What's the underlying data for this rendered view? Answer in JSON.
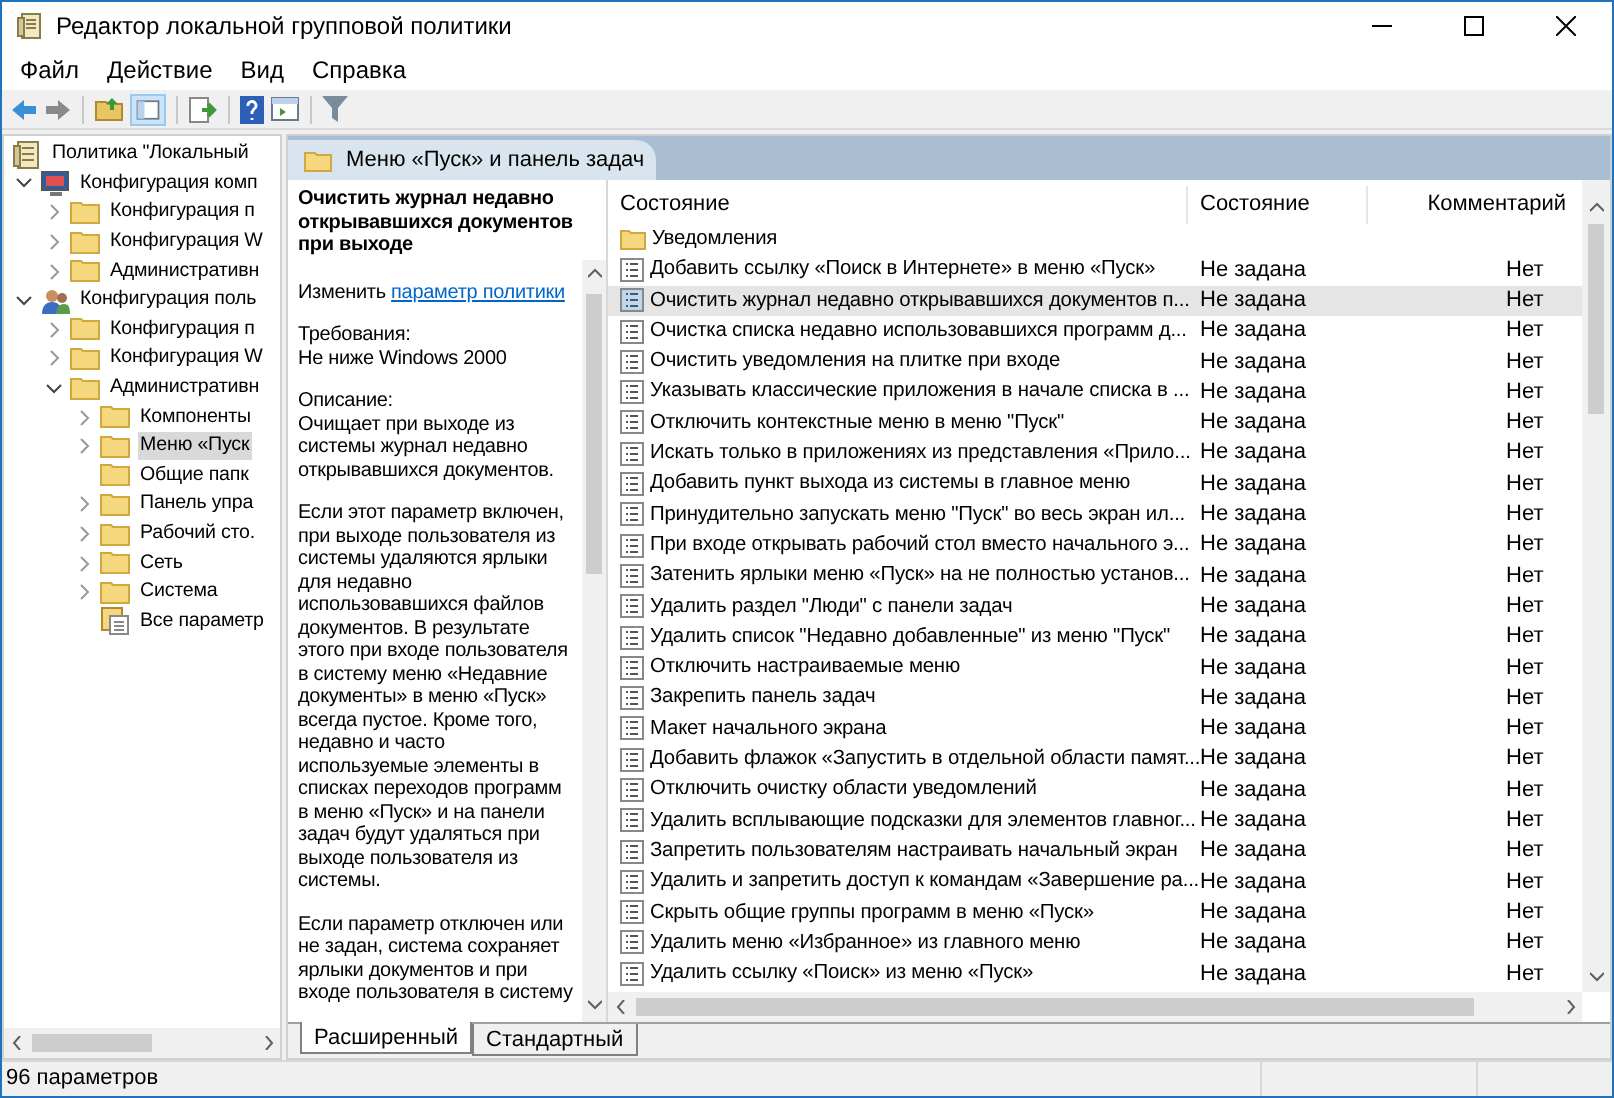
{
  "window": {
    "title": "Редактор локальной групповой политики"
  },
  "menu": [
    "Файл",
    "Действие",
    "Вид",
    "Справка"
  ],
  "tree": [
    {
      "label": "Политика \"Локальный",
      "kind": "policy",
      "selected": false,
      "children": [
        {
          "label": "Конфигурация комп",
          "kind": "computer",
          "expanded": true,
          "selected": false,
          "children": [
            {
              "label": "Конфигурация п",
              "kind": "folder",
              "expanded": false,
              "selected": false
            },
            {
              "label": "Конфигурация W",
              "kind": "folder",
              "expanded": false,
              "selected": false
            },
            {
              "label": "Административн",
              "kind": "folder",
              "expanded": false,
              "selected": false
            }
          ]
        },
        {
          "label": "Конфигурация поль",
          "kind": "user",
          "expanded": true,
          "selected": false,
          "children": [
            {
              "label": "Конфигурация п",
              "kind": "folder",
              "expanded": false,
              "selected": false
            },
            {
              "label": "Конфигурация W",
              "kind": "folder",
              "expanded": false,
              "selected": false
            },
            {
              "label": "Административн",
              "kind": "folder",
              "expanded": true,
              "selected": false,
              "children": [
                {
                  "label": "Компоненты",
                  "kind": "folder",
                  "expanded": false,
                  "selected": false
                },
                {
                  "label": "Меню «Пуск",
                  "kind": "folder",
                  "expanded": false,
                  "selected": true
                },
                {
                  "label": "Общие папк",
                  "kind": "folder",
                  "selected": false
                },
                {
                  "label": "Панель упра",
                  "kind": "folder",
                  "expanded": false,
                  "selected": false
                },
                {
                  "label": "Рабочий сто.",
                  "kind": "folder",
                  "expanded": false,
                  "selected": false
                },
                {
                  "label": "Сеть",
                  "kind": "folder",
                  "expanded": false,
                  "selected": false
                },
                {
                  "label": "Система",
                  "kind": "folder",
                  "expanded": false,
                  "selected": false
                },
                {
                  "label": "Все параметр",
                  "kind": "all",
                  "selected": false
                }
              ]
            }
          ]
        }
      ]
    }
  ],
  "header": "Меню «Пуск» и панель задач",
  "description": {
    "title": "Очистить журнал недавно открывавшихся документов при выходе",
    "edit_prefix": "Изменить",
    "edit_link": "параметр политики",
    "requirements_label": "Требования:",
    "requirements": "Не ниже Windows 2000",
    "description_label": "Описание:",
    "paragraphs": [
      "Очищает при выходе из системы журнал недавно открывавшихся документов.",
      "Если этот параметр включен, при выходе пользователя из системы удаляются ярлыки для недавно использовавшихся файлов документов. В результате этого при входе пользователя в систему меню «Недавние документы» в меню «Пуск» всегда пустое. Кроме того, недавно и часто используемые элементы в списках переходов программ в меню «Пуск» и на панели задач будут удаляться при выходе пользователя из системы.",
      "Если параметр отключен или не задан, система сохраняет ярлыки документов и при входе пользователя в систему"
    ]
  },
  "table": {
    "columns": [
      "Состояние",
      "Состояние",
      "Комментарий"
    ],
    "rows": [
      {
        "kind": "folder",
        "name": "Уведомления",
        "selected": false
      },
      {
        "kind": "setting",
        "name": "Добавить ссылку «Поиск в Интернете» в меню «Пуск»",
        "state": "Не задана",
        "comment": "Нет",
        "selected": false
      },
      {
        "kind": "setting",
        "name": "Очистить журнал недавно открывавшихся документов п...",
        "state": "Не задана",
        "comment": "Нет",
        "selected": true
      },
      {
        "kind": "setting",
        "name": "Очистка списка недавно использовавшихся программ д...",
        "state": "Не задана",
        "comment": "Нет",
        "selected": false
      },
      {
        "kind": "setting",
        "name": "Очистить уведомления на плитке при входе",
        "state": "Не задана",
        "comment": "Нет",
        "selected": false
      },
      {
        "kind": "setting",
        "name": "Указывать классические приложения в начале списка в ...",
        "state": "Не задана",
        "comment": "Нет",
        "selected": false
      },
      {
        "kind": "setting",
        "name": "Отключить контекстные меню в меню \"Пуск\"",
        "state": "Не задана",
        "comment": "Нет",
        "selected": false
      },
      {
        "kind": "setting",
        "name": "Искать только в приложениях из представления «Прило...",
        "state": "Не задана",
        "comment": "Нет",
        "selected": false
      },
      {
        "kind": "setting",
        "name": "Добавить пункт выхода из системы в главное меню",
        "state": "Не задана",
        "comment": "Нет",
        "selected": false
      },
      {
        "kind": "setting",
        "name": "Принудительно запускать меню \"Пуск\" во весь экран ил...",
        "state": "Не задана",
        "comment": "Нет",
        "selected": false
      },
      {
        "kind": "setting",
        "name": "При входе открывать рабочий стол вместо начального э...",
        "state": "Не задана",
        "comment": "Нет",
        "selected": false
      },
      {
        "kind": "setting",
        "name": "Затенить ярлыки меню «Пуск» на не полностью установ...",
        "state": "Не задана",
        "comment": "Нет",
        "selected": false
      },
      {
        "kind": "setting",
        "name": "Удалить раздел \"Люди\" с панели задач",
        "state": "Не задана",
        "comment": "Нет",
        "selected": false
      },
      {
        "kind": "setting",
        "name": "Удалить список \"Недавно добавленные\" из меню \"Пуск\"",
        "state": "Не задана",
        "comment": "Нет",
        "selected": false
      },
      {
        "kind": "setting",
        "name": "Отключить настраиваемые меню",
        "state": "Не задана",
        "comment": "Нет",
        "selected": false
      },
      {
        "kind": "setting",
        "name": "Закрепить панель задач",
        "state": "Не задана",
        "comment": "Нет",
        "selected": false
      },
      {
        "kind": "setting",
        "name": "Макет начального экрана",
        "state": "Не задана",
        "comment": "Нет",
        "selected": false
      },
      {
        "kind": "setting",
        "name": "Добавить флажок «Запустить в отдельной области памят...",
        "state": "Не задана",
        "comment": "Нет",
        "selected": false
      },
      {
        "kind": "setting",
        "name": "Отключить очистку области уведомлений",
        "state": "Не задана",
        "comment": "Нет",
        "selected": false
      },
      {
        "kind": "setting",
        "name": "Удалить всплывающие подсказки для элементов главног...",
        "state": "Не задана",
        "comment": "Нет",
        "selected": false
      },
      {
        "kind": "setting",
        "name": "Запретить пользователям настраивать начальный экран",
        "state": "Не задана",
        "comment": "Нет",
        "selected": false
      },
      {
        "kind": "setting",
        "name": "Удалить и запретить доступ к командам «Завершение ра...",
        "state": "Не задана",
        "comment": "Нет",
        "selected": false
      },
      {
        "kind": "setting",
        "name": "Скрыть общие группы программ в меню «Пуск»",
        "state": "Не задана",
        "comment": "Нет",
        "selected": false
      },
      {
        "kind": "setting",
        "name": "Удалить меню «Избранное» из главного меню",
        "state": "Не задана",
        "comment": "Нет",
        "selected": false
      },
      {
        "kind": "setting",
        "name": "Удалить ссылку «Поиск» из меню «Пуск»",
        "state": "Не задана",
        "comment": "Нет",
        "selected": false
      }
    ]
  },
  "tabs": [
    {
      "label": "Расширенный",
      "selected": true
    },
    {
      "label": "Стандартный",
      "selected": false
    }
  ],
  "status_bar": "96 параметров"
}
